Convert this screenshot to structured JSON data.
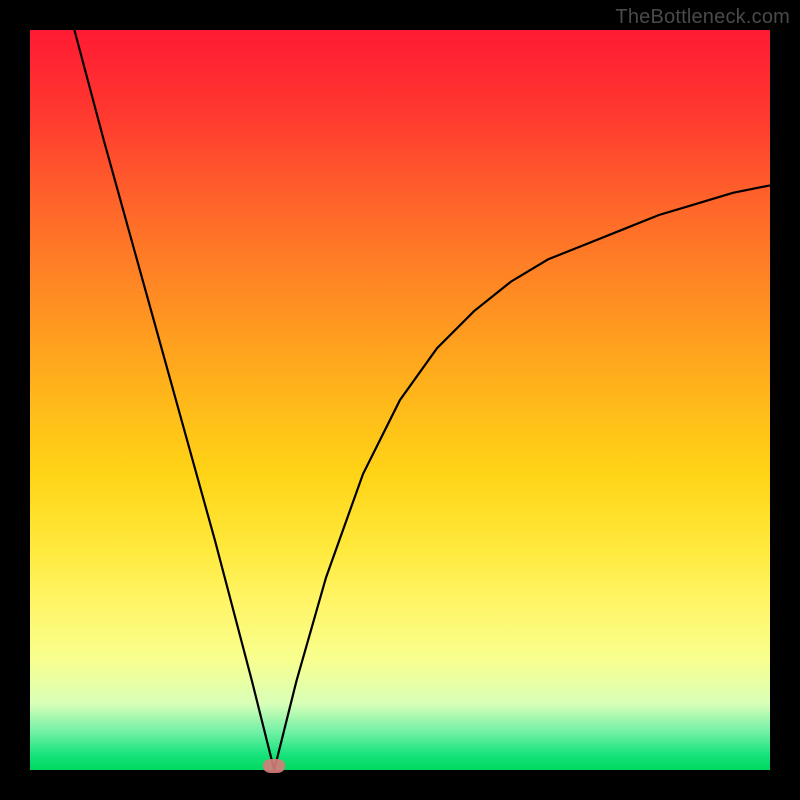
{
  "watermark": "TheBottleneck.com",
  "chart_data": {
    "type": "line",
    "title": "",
    "xlabel": "",
    "ylabel": "",
    "xlim": [
      0,
      100
    ],
    "ylim": [
      0,
      100
    ],
    "grid": false,
    "legend": false,
    "annotations": [],
    "marker": {
      "x": 33,
      "y": 0
    },
    "series": [
      {
        "name": "curve",
        "x": [
          6,
          10,
          15,
          20,
          25,
          30,
          33,
          36,
          40,
          45,
          50,
          55,
          60,
          65,
          70,
          75,
          80,
          85,
          90,
          95,
          100
        ],
        "y": [
          100,
          85,
          67,
          49,
          31,
          12,
          0,
          12,
          26,
          40,
          50,
          57,
          62,
          66,
          69,
          71,
          73,
          75,
          76.5,
          78,
          79
        ]
      }
    ],
    "background_gradient_stops": [
      {
        "pos": 0,
        "color": "#ff1a33"
      },
      {
        "pos": 12,
        "color": "#ff3b2f"
      },
      {
        "pos": 25,
        "color": "#ff6a2a"
      },
      {
        "pos": 37,
        "color": "#ff8f22"
      },
      {
        "pos": 50,
        "color": "#ffb81a"
      },
      {
        "pos": 60,
        "color": "#ffd416"
      },
      {
        "pos": 70,
        "color": "#ffe93c"
      },
      {
        "pos": 78,
        "color": "#fff66a"
      },
      {
        "pos": 85,
        "color": "#f8ff8e"
      },
      {
        "pos": 91,
        "color": "#d9ffb8"
      },
      {
        "pos": 95,
        "color": "#6df0a5"
      },
      {
        "pos": 98,
        "color": "#16e37a"
      },
      {
        "pos": 100,
        "color": "#00d85e"
      }
    ]
  }
}
